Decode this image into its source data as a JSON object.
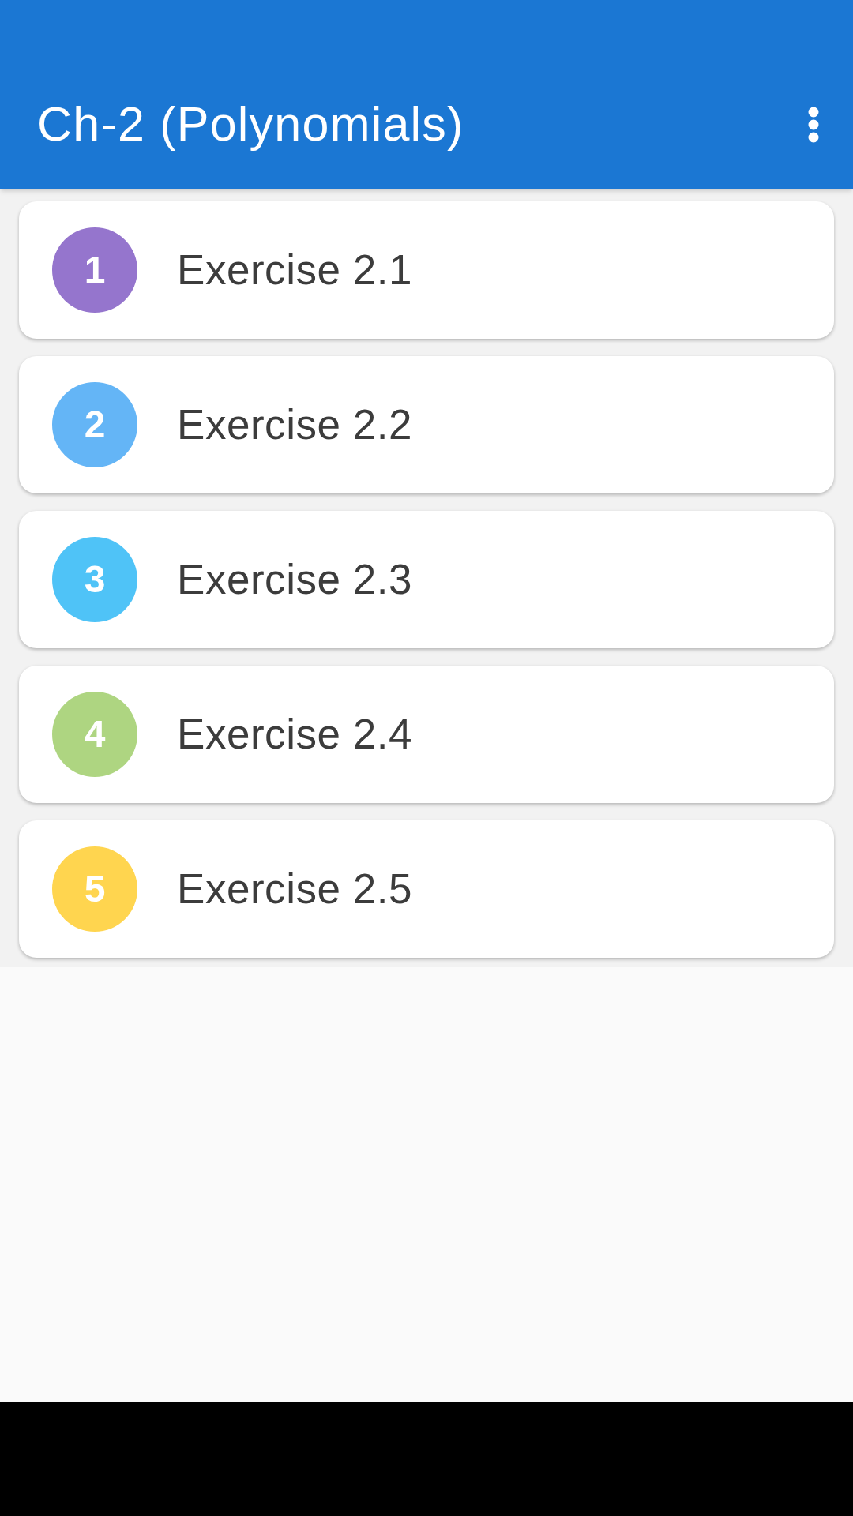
{
  "app_bar": {
    "title": "Ch-2 (Polynomials)"
  },
  "exercises": [
    {
      "number": "1",
      "label": "Exercise 2.1",
      "color": "#9575cd"
    },
    {
      "number": "2",
      "label": "Exercise 2.2",
      "color": "#64b5f6"
    },
    {
      "number": "3",
      "label": "Exercise 2.3",
      "color": "#4fc3f7"
    },
    {
      "number": "4",
      "label": "Exercise 2.4",
      "color": "#aed581"
    },
    {
      "number": "5",
      "label": "Exercise 2.5",
      "color": "#ffd54f"
    }
  ]
}
